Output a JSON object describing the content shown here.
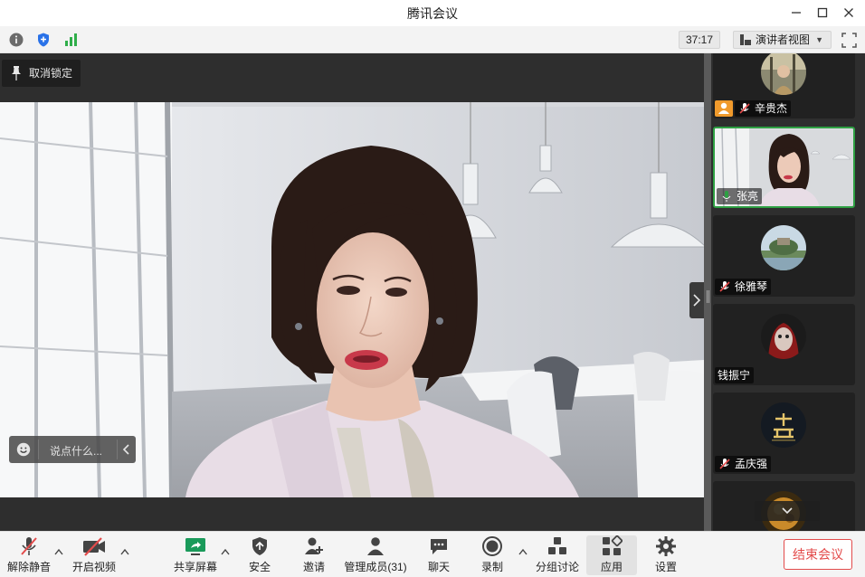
{
  "window": {
    "title": "腾讯会议"
  },
  "infobar": {
    "timer": "37:17",
    "view_mode": "演讲者视图",
    "icons": [
      "info-icon",
      "shield-icon",
      "signal-icon",
      "fullscreen-icon"
    ]
  },
  "stage": {
    "unlock_label": "取消锁定",
    "chat_placeholder": "说点什么...",
    "speaker_name": "张亮"
  },
  "participants": [
    {
      "name": "辛贵杰",
      "muted": true,
      "host": true
    },
    {
      "name": "张亮",
      "muted": false,
      "speaking": true
    },
    {
      "name": "徐雅琴",
      "muted": true
    },
    {
      "name": "钱振宁",
      "muted": false,
      "mic_hidden": true
    },
    {
      "name": "孟庆强",
      "muted": true
    },
    {
      "name": "",
      "muted": false
    }
  ],
  "toolbar": {
    "unmute": "解除静音",
    "video": "开启视频",
    "share": "共享屏幕",
    "security": "安全",
    "invite": "邀请",
    "members": "管理成员(31)",
    "chat": "聊天",
    "record": "录制",
    "breakout": "分组讨论",
    "apps": "应用",
    "settings": "设置",
    "end": "结束会议"
  },
  "colors": {
    "accent_green": "#2ea043",
    "end_red": "#e34b4b",
    "host_orange": "#f09a2c",
    "share_green": "#1a9a5a"
  }
}
